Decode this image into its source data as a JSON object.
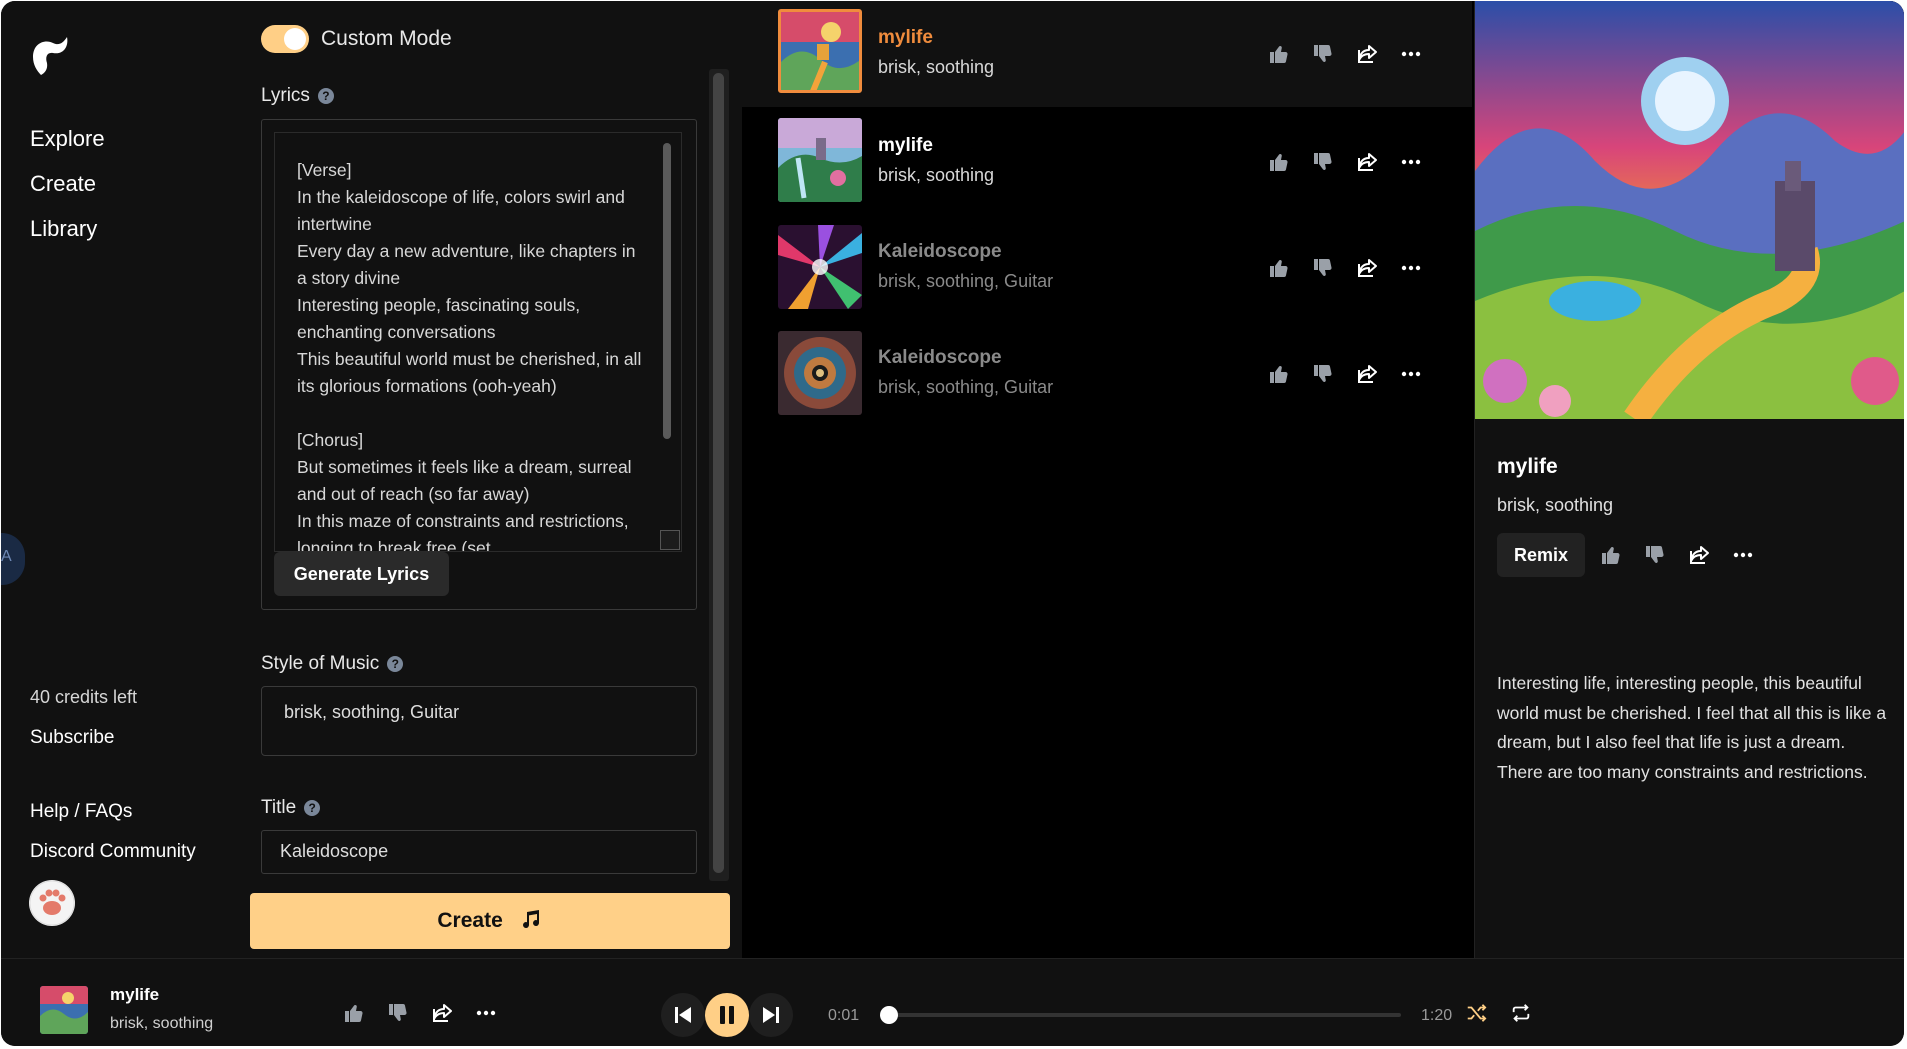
{
  "sidebar": {
    "nav": [
      "Explore",
      "Create",
      "Library"
    ],
    "credits": "40 credits left",
    "subscribe": "Subscribe",
    "help": "Help / FAQs",
    "discord": "Discord Community",
    "side_tab": "A"
  },
  "create": {
    "custom_mode": "Custom Mode",
    "custom_mode_on": true,
    "lyrics_label": "Lyrics",
    "lyrics": "[Verse]\nIn the kaleidoscope of life, colors swirl and intertwine\nEvery day a new adventure, like chapters in a story divine\nInteresting people, fascinating souls, enchanting conversations\nThis beautiful world must be cherished, in all its glorious formations (ooh-yeah)\n\n[Chorus]\nBut sometimes it feels like a dream, surreal and out of reach (so far away)\nIn this maze of constraints and restrictions, longing to break free (set",
    "generate_lyrics": "Generate Lyrics",
    "style_label": "Style of Music",
    "style_value": "brisk, soothing, Guitar",
    "title_label": "Title",
    "title_value": "Kaleidoscope",
    "create_button": "Create"
  },
  "songs": [
    {
      "title": "mylife",
      "tags": "brisk, soothing",
      "active": true
    },
    {
      "title": "mylife",
      "tags": "brisk, soothing",
      "active": false
    },
    {
      "title": "Kaleidoscope",
      "tags": "brisk, soothing, Guitar",
      "active": false
    },
    {
      "title": "Kaleidoscope",
      "tags": "brisk, soothing, Guitar",
      "active": false
    }
  ],
  "detail": {
    "title": "mylife",
    "tags": "brisk, soothing",
    "remix": "Remix",
    "description": "Interesting life, interesting people, this beautiful world must be cherished. I feel that all this is like a dream, but I also feel that life is just a dream. There are too many constraints and restrictions."
  },
  "player": {
    "title": "mylife",
    "tags": "brisk, soothing",
    "current_time": "0:01",
    "duration": "1:20",
    "progress_fraction": 0.0125
  },
  "colors": {
    "accent": "#ffcf86",
    "active_title": "#f08c3d",
    "dimmed_text": "#8a8a8a"
  }
}
